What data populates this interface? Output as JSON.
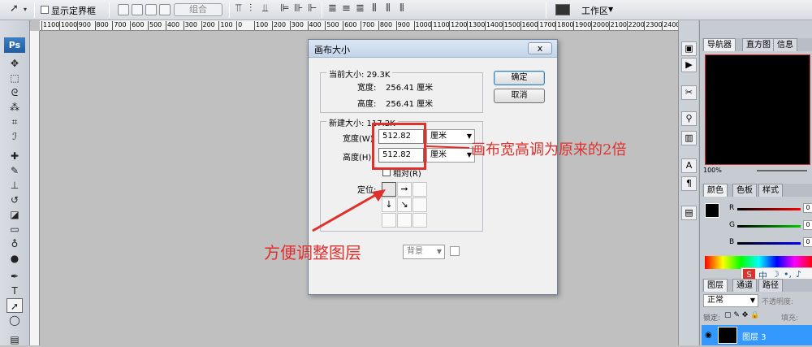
{
  "options_bar": {
    "show_bounds_label": "显示定界框",
    "group_button": "组合",
    "workspace_label": "工作区"
  },
  "ruler": {
    "ticks": [
      "1100",
      "1000",
      "900",
      "800",
      "700",
      "600",
      "500",
      "400",
      "300",
      "200",
      "100",
      "0",
      "100",
      "200",
      "300",
      "400",
      "500",
      "600",
      "700",
      "800",
      "900",
      "1000",
      "1100",
      "1200",
      "1300",
      "1400",
      "1500",
      "1600",
      "1700",
      "1800",
      "1900",
      "2000",
      "2100",
      "2200",
      "2300",
      "2400"
    ]
  },
  "toolbox": {
    "logo": "Ps"
  },
  "dialog": {
    "title": "画布大小",
    "close_label": "x",
    "current_size": {
      "title": "当前大小: 29.3K",
      "width_label": "宽度:",
      "width_value": "256.41 厘米",
      "height_label": "高度:",
      "height_value": "256.41 厘米"
    },
    "new_size": {
      "title": "新建大小: 117.2K",
      "width_label": "宽度(W)",
      "width_value": "512.82",
      "width_unit": "厘米",
      "height_label": "高度(H)",
      "height_value": "512.82",
      "height_unit": "厘米",
      "relative_label": "相对(R)",
      "anchor_label": "定位:"
    },
    "extension_color_value": "背景",
    "ok_button": "确定",
    "cancel_button": "取消"
  },
  "annotations": {
    "right_note": "画布宽高调为原来的2倍",
    "left_note": "方便调整图层"
  },
  "panels": {
    "navigator_tabs": [
      "导航器",
      "直方图",
      "信息"
    ],
    "zoom_value": "100%",
    "color_tabs": [
      "颜色",
      "色板",
      "样式"
    ],
    "color_channels": [
      "R",
      "G",
      "B"
    ],
    "color_values": [
      "0",
      "0",
      "0"
    ],
    "ime_label": "中",
    "layers_tabs": [
      "图层",
      "通道",
      "路径"
    ],
    "blend_mode": "正常",
    "opacity_label": "不透明度:",
    "lock_label": "锁定:",
    "fill_label": "填充:",
    "layer_name": "图层 3"
  },
  "colors": {
    "annotation_red": "#e0302c",
    "canvas_gray": "#c0c0c0",
    "layer_selected": "#3399ff"
  }
}
